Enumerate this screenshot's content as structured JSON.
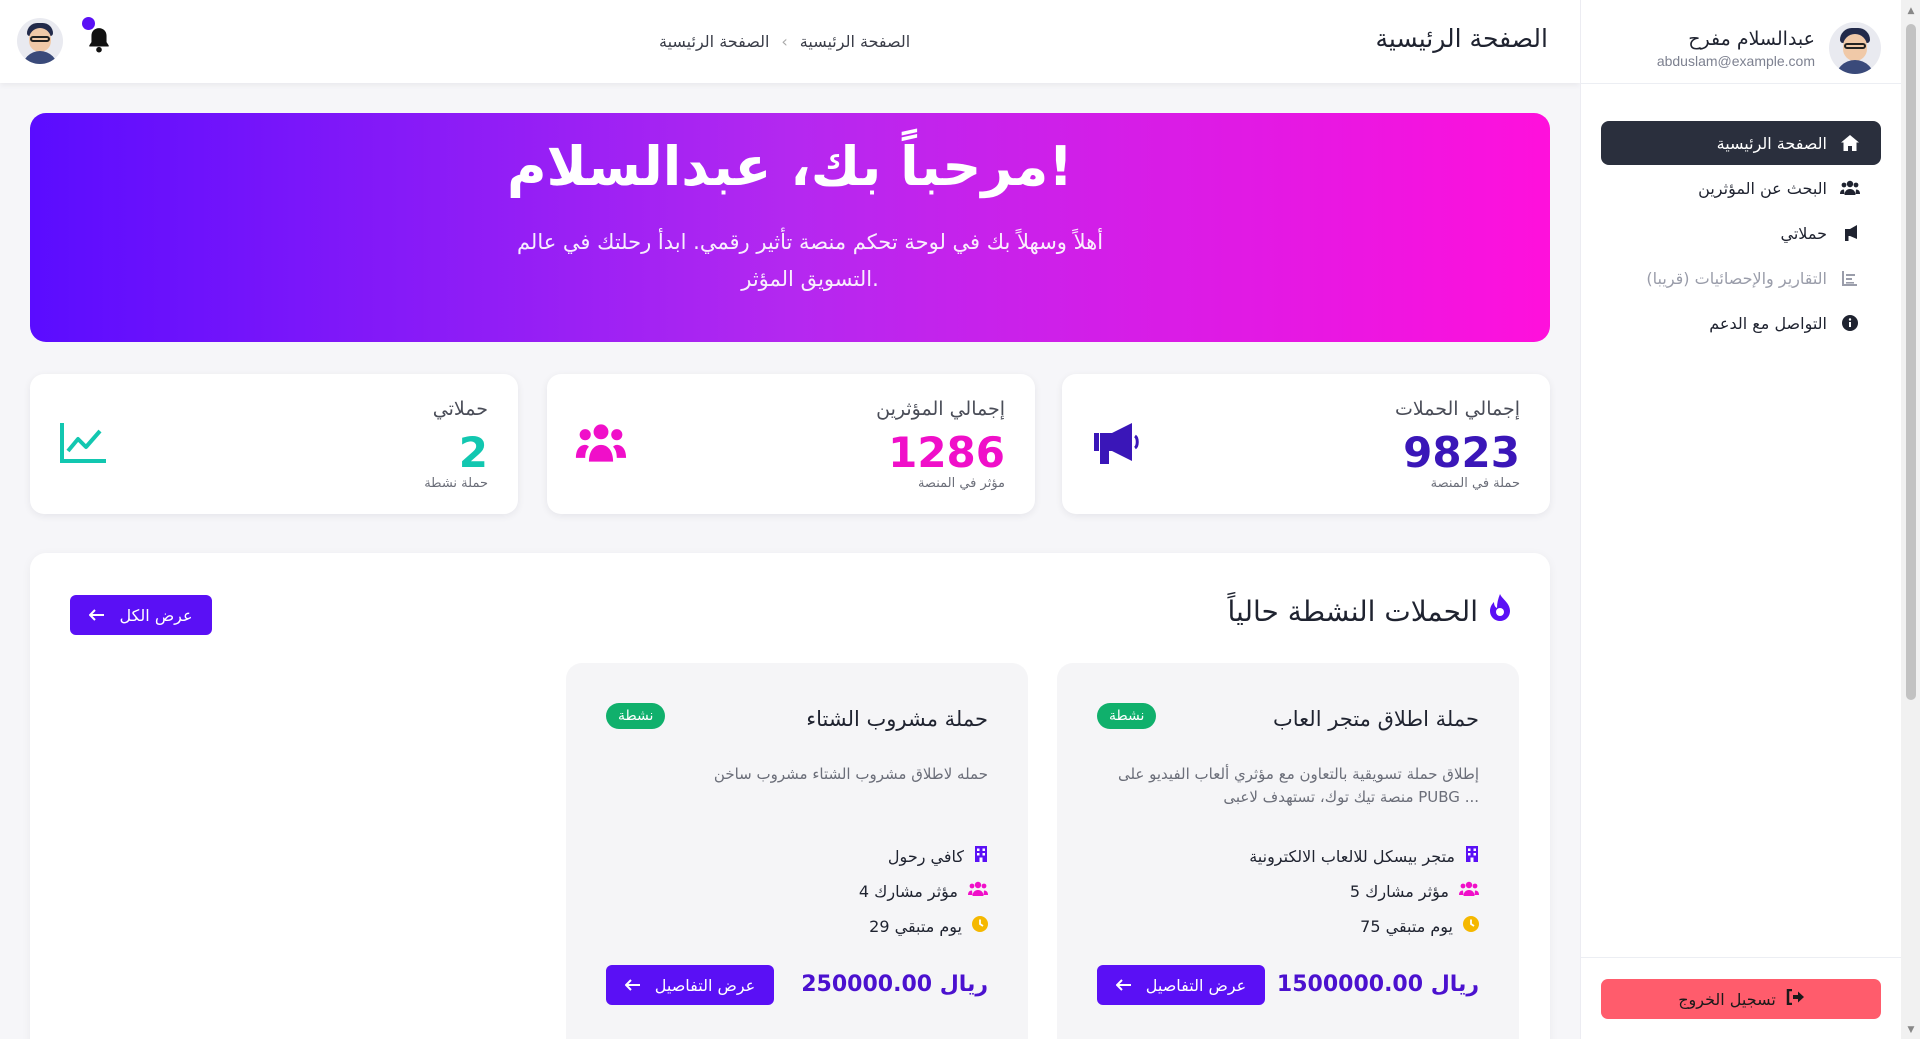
{
  "topbar": {
    "title": "الصفحة الرئيسية",
    "breadcrumb": [
      "الصفحة الرئيسية",
      "الصفحة الرئيسية"
    ]
  },
  "user": {
    "name": "عبدالسلام مفرح",
    "email": "abduslam@example.com"
  },
  "sidebar": {
    "items": [
      {
        "label": "الصفحة الرئيسية",
        "icon": "home-icon",
        "state": "active"
      },
      {
        "label": "البحث عن المؤثرين",
        "icon": "users-icon",
        "state": "normal"
      },
      {
        "label": "حملاتي",
        "icon": "megaphone-icon",
        "state": "normal"
      },
      {
        "label": "التقارير والإحصائيات (قريبا)",
        "icon": "chart-icon",
        "state": "disabled"
      },
      {
        "label": "التواصل مع الدعم",
        "icon": "info-icon",
        "state": "normal"
      }
    ],
    "logout_label": "تسجيل الخروج"
  },
  "hero": {
    "title": "مرحباً بك، عبدالسلام!",
    "subtitle": "أهلاً وسهلاً بك في لوحة تحكم منصة تأثير رقمي. ابدأ رحلتك في عالم التسويق المؤثر."
  },
  "stats": [
    {
      "label": "إجمالي الحملات",
      "value": "9823",
      "sub": "حملة في المنصة",
      "color": "#3a16b8",
      "icon": "megaphone-icon"
    },
    {
      "label": "إجمالي المؤثرين",
      "value": "1286",
      "sub": "مؤثر في المنصة",
      "color": "#f00fc9",
      "icon": "users-icon"
    },
    {
      "label": "حملاتي",
      "value": "2",
      "sub": "حملة نشطة",
      "color": "#12c7b0",
      "icon": "line-chart-icon"
    }
  ],
  "campaigns_section": {
    "title": "الحملات النشطة حالياً",
    "view_all_label": "عرض الكل"
  },
  "campaigns": [
    {
      "title": "حملة اطلاق متجر العاب",
      "status": "نشطة",
      "description": "إطلاق حملة تسويقية بالتعاون مع مؤثري ألعاب الفيديو على منصة تيك توك، تستهدف لاعبى PUBG ...",
      "brand": "متجر بيسكل للالعاب الالكترونية",
      "influencers": "5 مؤثر مشارك",
      "days_left": "75 يوم متبقي",
      "price": "1500000.00 ريال",
      "details_label": "عرض التفاصيل"
    },
    {
      "title": "حملة مشروب الشتاء",
      "status": "نشطة",
      "description": "حمله لاطلاق مشروب الشتاء مشروب ساخن",
      "brand": "كافي رحول",
      "influencers": "4 مؤثر مشارك",
      "days_left": "29 يوم متبقي",
      "price": "250000.00 ريال",
      "details_label": "عرض التفاصيل"
    }
  ],
  "colors": {
    "primary": "#5a10f5",
    "active_nav": "#2a2f3d",
    "logout": "#ff5c6c",
    "badge": "#10b06c",
    "hero_start": "#5a0cff",
    "hero_end": "#ff10dc"
  }
}
